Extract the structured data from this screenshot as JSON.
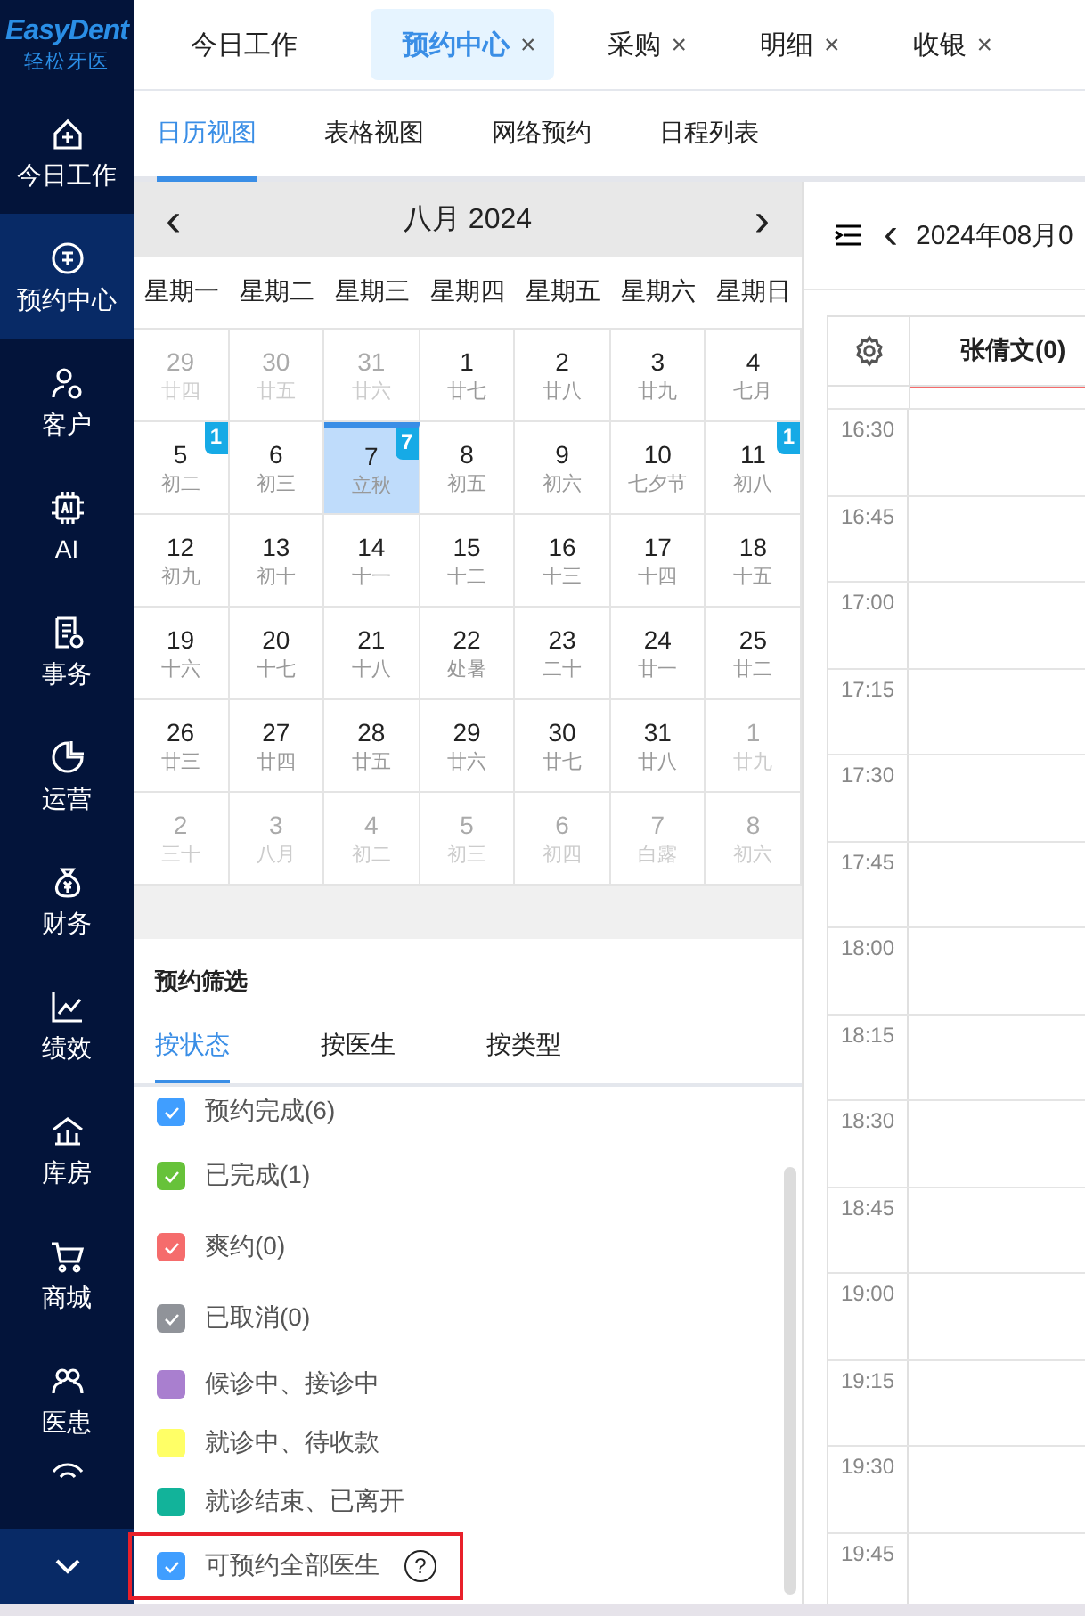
{
  "logo": {
    "brand": "EasyDent",
    "subtitle": "轻松牙医"
  },
  "sidebar": {
    "items": [
      {
        "label": "今日工作",
        "selected": false
      },
      {
        "label": "预约中心",
        "selected": true
      },
      {
        "label": "客户",
        "selected": false
      },
      {
        "label": "AI",
        "selected": false
      },
      {
        "label": "事务",
        "selected": false
      },
      {
        "label": "运营",
        "selected": false
      },
      {
        "label": "财务",
        "selected": false
      },
      {
        "label": "绩效",
        "selected": false
      },
      {
        "label": "库房",
        "selected": false
      },
      {
        "label": "商城",
        "selected": false
      },
      {
        "label": "医患",
        "selected": false
      }
    ]
  },
  "tabs": [
    {
      "label": "今日工作",
      "selected": false,
      "closable": false
    },
    {
      "label": "预约中心",
      "selected": true,
      "closable": true
    },
    {
      "label": "采购",
      "selected": false,
      "closable": true
    },
    {
      "label": "明细",
      "selected": false,
      "closable": true
    },
    {
      "label": "收银",
      "selected": false,
      "closable": true
    }
  ],
  "close_mark": "×",
  "view_tabs": [
    {
      "label": "日历视图",
      "selected": true
    },
    {
      "label": "表格视图",
      "selected": false
    },
    {
      "label": "网络预约",
      "selected": false
    },
    {
      "label": "日程列表",
      "selected": false
    }
  ],
  "calendar": {
    "prev": "‹",
    "month": "八月 2024",
    "next": "›",
    "weekdays": [
      "星期一",
      "星期二",
      "星期三",
      "星期四",
      "星期五",
      "星期六",
      "星期日"
    ],
    "days": [
      {
        "day": "29",
        "lunar": "廿四",
        "other_month": true,
        "selected": false
      },
      {
        "day": "30",
        "lunar": "廿五",
        "other_month": true,
        "selected": false
      },
      {
        "day": "31",
        "lunar": "廿六",
        "other_month": true,
        "selected": false
      },
      {
        "day": "1",
        "lunar": "廿七",
        "other_month": false,
        "selected": false
      },
      {
        "day": "2",
        "lunar": "廿八",
        "other_month": false,
        "selected": false
      },
      {
        "day": "3",
        "lunar": "廿九",
        "other_month": false,
        "selected": false
      },
      {
        "day": "4",
        "lunar": "七月",
        "other_month": false,
        "selected": false
      },
      {
        "day": "5",
        "lunar": "初二",
        "other_month": false,
        "selected": false,
        "badge": "1"
      },
      {
        "day": "6",
        "lunar": "初三",
        "other_month": false,
        "selected": false
      },
      {
        "day": "7",
        "lunar": "立秋",
        "other_month": false,
        "selected": true,
        "badge": "7"
      },
      {
        "day": "8",
        "lunar": "初五",
        "other_month": false,
        "selected": false
      },
      {
        "day": "9",
        "lunar": "初六",
        "other_month": false,
        "selected": false
      },
      {
        "day": "10",
        "lunar": "七夕节",
        "other_month": false,
        "selected": false
      },
      {
        "day": "11",
        "lunar": "初八",
        "other_month": false,
        "selected": false,
        "badge": "1"
      },
      {
        "day": "12",
        "lunar": "初九",
        "other_month": false,
        "selected": false
      },
      {
        "day": "13",
        "lunar": "初十",
        "other_month": false,
        "selected": false
      },
      {
        "day": "14",
        "lunar": "十一",
        "other_month": false,
        "selected": false
      },
      {
        "day": "15",
        "lunar": "十二",
        "other_month": false,
        "selected": false
      },
      {
        "day": "16",
        "lunar": "十三",
        "other_month": false,
        "selected": false
      },
      {
        "day": "17",
        "lunar": "十四",
        "other_month": false,
        "selected": false
      },
      {
        "day": "18",
        "lunar": "十五",
        "other_month": false,
        "selected": false
      },
      {
        "day": "19",
        "lunar": "十六",
        "other_month": false,
        "selected": false
      },
      {
        "day": "20",
        "lunar": "十七",
        "other_month": false,
        "selected": false
      },
      {
        "day": "21",
        "lunar": "十八",
        "other_month": false,
        "selected": false
      },
      {
        "day": "22",
        "lunar": "处暑",
        "other_month": false,
        "selected": false
      },
      {
        "day": "23",
        "lunar": "二十",
        "other_month": false,
        "selected": false
      },
      {
        "day": "24",
        "lunar": "廿一",
        "other_month": false,
        "selected": false
      },
      {
        "day": "25",
        "lunar": "廿二",
        "other_month": false,
        "selected": false
      },
      {
        "day": "26",
        "lunar": "廿三",
        "other_month": false,
        "selected": false
      },
      {
        "day": "27",
        "lunar": "廿四",
        "other_month": false,
        "selected": false
      },
      {
        "day": "28",
        "lunar": "廿五",
        "other_month": false,
        "selected": false
      },
      {
        "day": "29",
        "lunar": "廿六",
        "other_month": false,
        "selected": false
      },
      {
        "day": "30",
        "lunar": "廿七",
        "other_month": false,
        "selected": false
      },
      {
        "day": "31",
        "lunar": "廿八",
        "other_month": false,
        "selected": false
      },
      {
        "day": "1",
        "lunar": "廿九",
        "other_month": true,
        "selected": false
      },
      {
        "day": "2",
        "lunar": "三十",
        "other_month": true,
        "selected": false
      },
      {
        "day": "3",
        "lunar": "八月",
        "other_month": true,
        "selected": false
      },
      {
        "day": "4",
        "lunar": "初二",
        "other_month": true,
        "selected": false
      },
      {
        "day": "5",
        "lunar": "初三",
        "other_month": true,
        "selected": false
      },
      {
        "day": "6",
        "lunar": "初四",
        "other_month": true,
        "selected": false
      },
      {
        "day": "7",
        "lunar": "白露",
        "other_month": true,
        "selected": false
      },
      {
        "day": "8",
        "lunar": "初六",
        "other_month": true,
        "selected": false
      }
    ]
  },
  "filter": {
    "title": "预约筛选",
    "tabs": [
      {
        "label": "按状态",
        "selected": true
      },
      {
        "label": "按医生",
        "selected": false
      },
      {
        "label": "按类型",
        "selected": false
      }
    ],
    "options": [
      {
        "kind": "checkbox",
        "label": "预约完成(6)",
        "checked": true,
        "color": "#409eff"
      },
      {
        "kind": "checkbox",
        "label": "已完成(1)",
        "checked": true,
        "color": "#67c23a"
      },
      {
        "kind": "checkbox",
        "label": "爽约(0)",
        "checked": true,
        "color": "#f56c6c"
      },
      {
        "kind": "checkbox",
        "label": "已取消(0)",
        "checked": true,
        "color": "#909399"
      },
      {
        "kind": "swatch",
        "label": "候诊中、接诊中",
        "color": "#a97fcf"
      },
      {
        "kind": "swatch",
        "label": "就诊中、待收款",
        "color": "#ffff66"
      },
      {
        "kind": "swatch",
        "label": "就诊结束、已离开",
        "color": "#12b39a"
      }
    ],
    "all_doctors": {
      "label": "可预约全部医生",
      "checked": true,
      "highlighted": true,
      "help": "?"
    }
  },
  "schedule": {
    "prev": "‹",
    "date": "2024年08月0",
    "doctor": "张倩文(0)",
    "times": [
      "16:30",
      "16:45",
      "17:00",
      "17:15",
      "17:30",
      "17:45",
      "18:00",
      "18:15",
      "18:30",
      "18:45",
      "19:00",
      "19:15",
      "19:30",
      "19:45"
    ]
  }
}
